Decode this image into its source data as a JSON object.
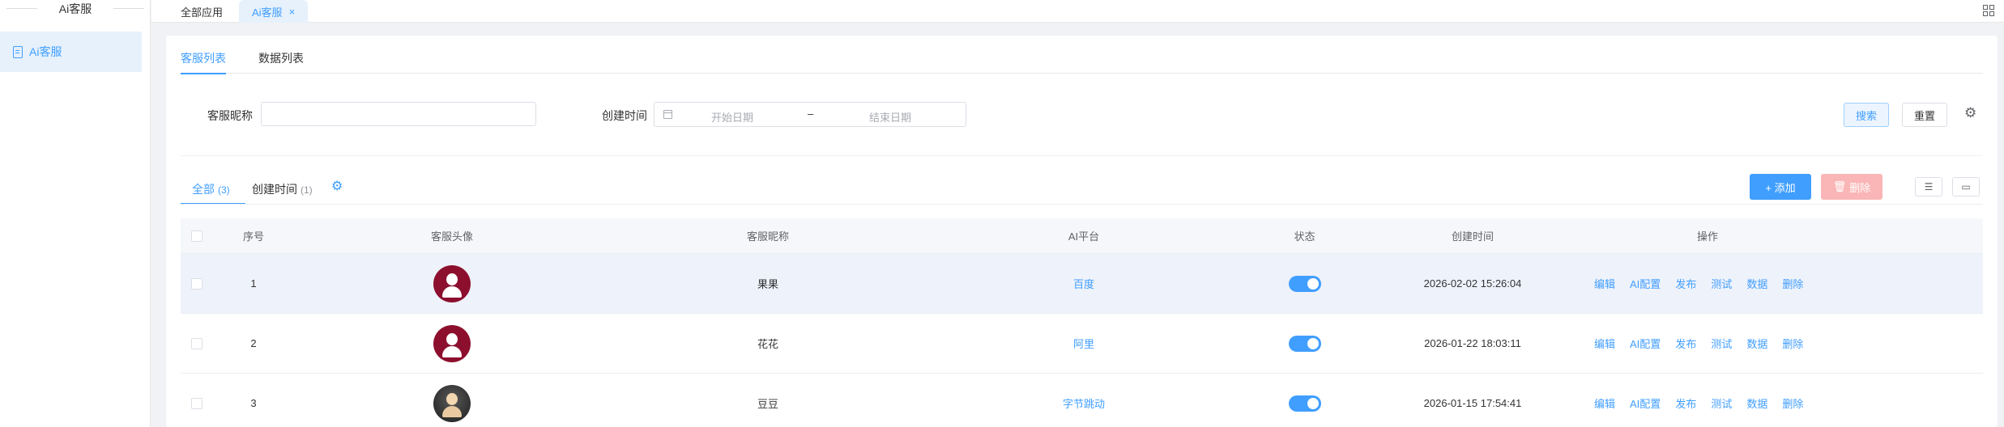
{
  "sidebar": {
    "title": "Ai客服",
    "items": [
      {
        "label": "Ai客服"
      }
    ]
  },
  "tabbar": {
    "tabs": [
      {
        "label": "全部应用"
      },
      {
        "label": "Ai客服"
      }
    ],
    "close_glyph": "×"
  },
  "subtabs": [
    {
      "label": "客服列表"
    },
    {
      "label": "数据列表"
    }
  ],
  "filters": {
    "nickname_label": "客服昵称",
    "nickname_value": "",
    "created_label": "创建时间",
    "start_placeholder": "开始日期",
    "range_separator": "–",
    "end_placeholder": "结束日期",
    "search_label": "搜索",
    "reset_label": "重置"
  },
  "list_tabs": [
    {
      "label": "全部",
      "count": "(3)"
    },
    {
      "label": "创建时间",
      "count": "(1)"
    }
  ],
  "toolbar": {
    "add_label": "+ 添加",
    "delete_label": "删除"
  },
  "table": {
    "headers": [
      "序号",
      "客服头像",
      "客服昵称",
      "AI平台",
      "状态",
      "创建时间",
      "操作"
    ],
    "rows": [
      {
        "seq": "1",
        "nickname": "果果",
        "platform": "百度",
        "enabled": true,
        "created": "2026-02-02 15:26:04"
      },
      {
        "seq": "2",
        "nickname": "花花",
        "platform": "阿里",
        "enabled": true,
        "created": "2026-01-22 18:03:11"
      },
      {
        "seq": "3",
        "nickname": "豆豆",
        "platform": "字节跳动",
        "enabled": true,
        "created": "2026-01-15 17:54:41"
      }
    ],
    "actions": [
      "编辑",
      "AI配置",
      "发布",
      "测试",
      "数据",
      "删除"
    ]
  },
  "colors": {
    "accent": "#409eff",
    "danger_light": "#fab6b6",
    "avatar_red": "#8c0f2e"
  },
  "icons": [
    "document-icon",
    "close-icon",
    "grid-icon",
    "calendar-icon",
    "gear-icon",
    "trash-icon",
    "column-settings-icon",
    "folder-icon"
  ]
}
